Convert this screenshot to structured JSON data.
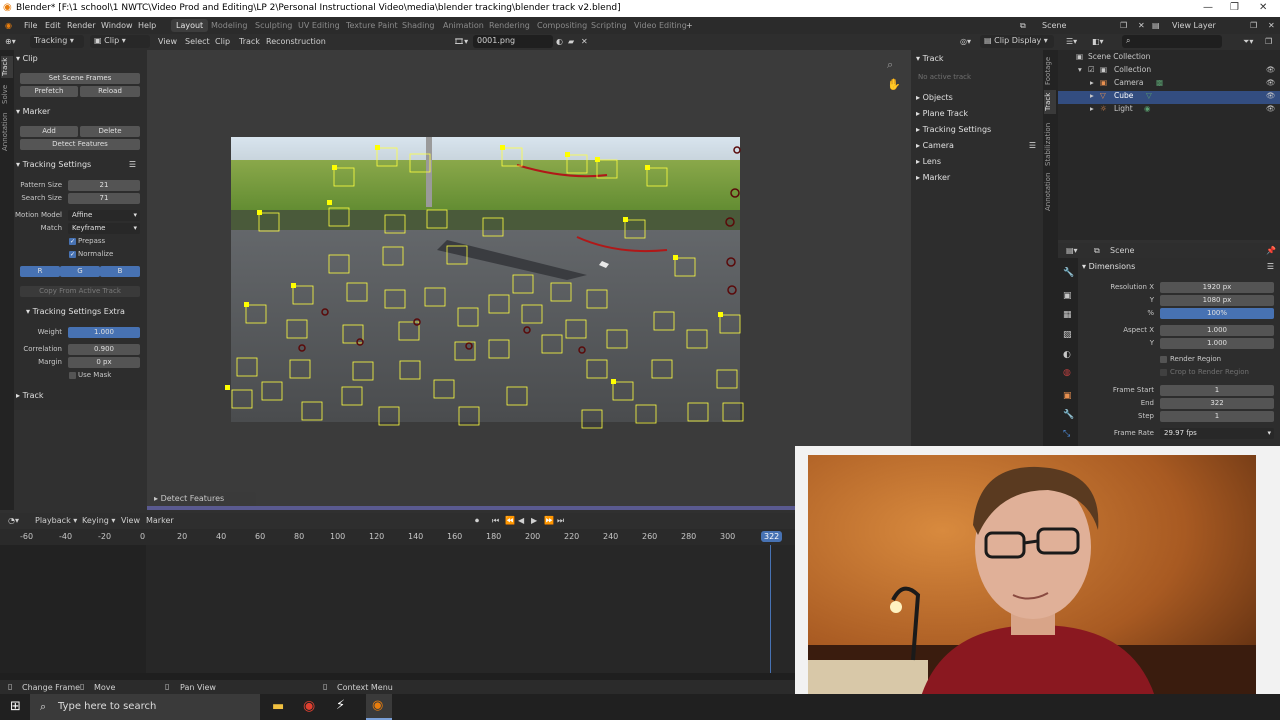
{
  "window": {
    "title": "Blender* [F:\\1 school\\1 NWTC\\Video Prod and Editing\\LP 2\\Personal Instructional Video\\media\\blender tracking\\blender track v2.blend]"
  },
  "menubar": {
    "menus": [
      "File",
      "Edit",
      "Render",
      "Window",
      "Help"
    ],
    "workspaces": [
      "Layout",
      "Modeling",
      "Sculpting",
      "UV Editing",
      "Texture Paint",
      "Shading",
      "Animation",
      "Rendering",
      "Compositing",
      "Scripting",
      "Video Editing"
    ],
    "scene": "Scene",
    "view_layer": "View Layer"
  },
  "clip_header": {
    "mode": "Tracking",
    "view": "Clip",
    "menus": [
      "View",
      "Select",
      "Clip",
      "Track",
      "Reconstruction"
    ],
    "file": "0001.png",
    "display": "Clip Display"
  },
  "left_tabs": [
    "Track",
    "Solve",
    "Annotation"
  ],
  "left_panel": {
    "clip_header": "Clip",
    "set_scene_frames": "Set Scene Frames",
    "prefetch": "Prefetch",
    "reload": "Reload",
    "marker_header": "Marker",
    "add": "Add",
    "delete": "Delete",
    "detect_features": "Detect Features",
    "tracking_settings_header": "Tracking Settings",
    "pattern_size_label": "Pattern Size",
    "pattern_size": "21",
    "search_size_label": "Search Size",
    "search_size": "71",
    "motion_model_label": "Motion Model",
    "motion_model": "Affine",
    "match_label": "Match",
    "match": "Keyframe",
    "prepass": "Prepass",
    "normalize": "Normalize",
    "channel_r": "R",
    "channel_g": "G",
    "channel_b": "B",
    "copy_from_active": "Copy From Active Track",
    "extra_header": "Tracking Settings Extra",
    "weight_label": "Weight",
    "weight": "1.000",
    "correlation_label": "Correlation",
    "correlation": "0.900",
    "margin_label": "Margin",
    "margin": "0 px",
    "use_mask": "Use Mask",
    "track_header": "Track"
  },
  "right_panel": {
    "track_header": "Track",
    "no_active": "No active track",
    "sections": [
      "Objects",
      "Plane Track",
      "Tracking Settings",
      "Camera",
      "Lens",
      "Marker"
    ]
  },
  "right_tabs": [
    "Footage",
    "Track",
    "Stabilization",
    "Annotation"
  ],
  "outliner": {
    "root": "Scene Collection",
    "collection": "Collection",
    "items": [
      "Camera",
      "Cube",
      "Light"
    ]
  },
  "properties": {
    "scene": "Scene",
    "dimensions_header": "Dimensions",
    "res_x_label": "Resolution X",
    "res_x": "1920 px",
    "res_y_label": "Y",
    "res_y": "1080 px",
    "pct_label": "%",
    "pct": "100%",
    "aspect_x_label": "Aspect X",
    "aspect_x": "1.000",
    "aspect_y_label": "Y",
    "aspect_y": "1.000",
    "render_region": "Render Region",
    "crop": "Crop to Render Region",
    "frame_start_label": "Frame Start",
    "frame_start": "1",
    "end_label": "End",
    "end": "322",
    "step_label": "Step",
    "step": "1",
    "frame_rate_label": "Frame Rate",
    "frame_rate": "29.97 fps"
  },
  "operator_panel": "Detect Features",
  "timeline": {
    "menus": [
      "Playback",
      "Keying",
      "View",
      "Marker"
    ],
    "ruler": [
      "-60",
      "-40",
      "-20",
      "0",
      "20",
      "40",
      "60",
      "80",
      "100",
      "120",
      "140",
      "160",
      "180",
      "200",
      "220",
      "240",
      "260",
      "280",
      "300"
    ],
    "current_frame": "322"
  },
  "status": {
    "change_frame": "Change Frame",
    "move": "Move",
    "pan_view": "Pan View",
    "context_menu": "Context Menu"
  },
  "taskbar": {
    "search_placeholder": "Type here to search"
  },
  "colors": {
    "accent": "#4772b3",
    "marker": "#ffff00",
    "selected_row": "#334d80",
    "playhead": "#4772b3"
  }
}
